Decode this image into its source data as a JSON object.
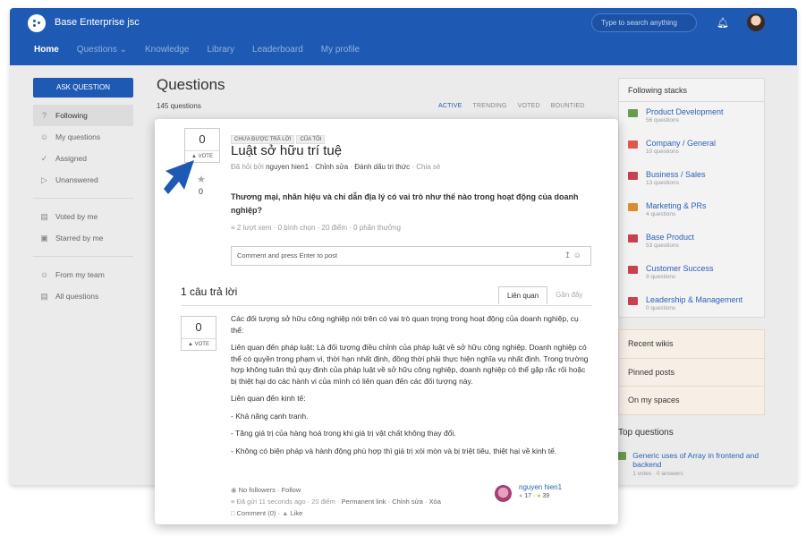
{
  "app": {
    "name": "Base Enterprise jsc",
    "search_placeholder": "Type to search anything"
  },
  "nav": {
    "items": [
      "Home",
      "Questions ⌄",
      "Knowledge",
      "Library",
      "Leaderboard",
      "My profile"
    ]
  },
  "sidebar": {
    "ask_label": "ASK QUESTION",
    "group1": [
      {
        "label": "Following",
        "icon": "question-circle-icon"
      },
      {
        "label": "My questions",
        "icon": "user-icon"
      },
      {
        "label": "Assigned",
        "icon": "check-circle-icon"
      },
      {
        "label": "Unanswered",
        "icon": "paper-plane-icon"
      }
    ],
    "group2": [
      {
        "label": "Voted by me",
        "icon": "vote-box-icon"
      },
      {
        "label": "Starred by me",
        "icon": "star-box-icon"
      }
    ],
    "group3": [
      {
        "label": "From my team",
        "icon": "team-icon"
      },
      {
        "label": "All questions",
        "icon": "document-icon"
      }
    ]
  },
  "main": {
    "title": "Questions",
    "count": "145 questions",
    "tabs": [
      "ACTIVE",
      "TRENDING",
      "VOTED",
      "BOUNTIED"
    ]
  },
  "right": {
    "stacks_title": "Following stacks",
    "stacks": [
      {
        "name": "Product Development",
        "count": "56 questions",
        "color": "#6a9a4b"
      },
      {
        "name": "Company / General",
        "count": "10 questions",
        "color": "#e2574c"
      },
      {
        "name": "Business / Sales",
        "count": "13 questions",
        "color": "#c9404f"
      },
      {
        "name": "Marketing & PRs",
        "count": "4 questions",
        "color": "#e08a2e"
      },
      {
        "name": "Base Product",
        "count": "53 questions",
        "color": "#c9404f"
      },
      {
        "name": "Customer Success",
        "count": "9 questions",
        "color": "#c9404f"
      },
      {
        "name": "Leadership & Management",
        "count": "0 questions",
        "color": "#c9404f"
      }
    ],
    "wiki_items": [
      "Recent wikis",
      "Pinned posts",
      "On my spaces"
    ],
    "top_questions_title": "Top questions",
    "top_question": {
      "title": "Generic uses of Array in frontend and backend",
      "meta": "1 votes · 0 answers"
    }
  },
  "question": {
    "votes": "0",
    "vote_label": "▲ VOTE",
    "stars": "0",
    "tags": [
      "CHƯA ĐƯỢC TRẢ LỜI",
      "CỦA TÔI"
    ],
    "title": "Luật sở hữu trí tuệ",
    "asked_by": "Đã hỏi bởi",
    "author": "nguyen hien1",
    "edit": "Chỉnh sửa",
    "mark": "Đánh dấu tri thức",
    "share": "Chia sẻ",
    "body": "Thương mại, nhãn hiệu và chỉ dẫn địa lý có vai trò như thế nào trong hoạt động của doanh nghiệp?",
    "stats": "≡ 2 lượt xem · 0 bình chọn · 20 điểm · 0 phần thưởng",
    "comment_placeholder": "Comment and press Enter to post"
  },
  "answers": {
    "heading": "1 câu trả lời",
    "tab_relevant": "Liên quan",
    "tab_recent": "Gần đây",
    "votes": "0",
    "vote_label": "▲ VOTE",
    "paragraphs": [
      "Các đối tượng sở hữu công nghiệp nói trên có vai trò quan trọng trong hoạt động của doanh nghiệp, cụ thể:",
      "Liên quan đến pháp luật: Là đối tượng điều chỉnh của pháp luật về sở hữu công nghiệp. Doanh nghiệp có thể có quyền trong phạm vi, thời hạn nhất định, đồng thời phải thực hiện nghĩa vụ nhất định. Trong trường hợp không tuân thủ quy định của pháp luật về sở hữu công nghiệp, doanh nghiệp có thể gặp rắc rối hoặc bị thiệt hại do các hành vi của mình có liên quan đến các đối tượng này.",
      "Liên quan đến kinh tế:",
      "- Khả năng cạnh tranh.",
      "- Tăng giá trị của hàng hoá trong khi giá trị vật chất không thay đổi.",
      "- Không có biện pháp và hành động phù hợp thì giá trị xói mòn và bị triệt tiêu, thiệt hại về kinh tế."
    ],
    "followers": "No followers",
    "follow": "Follow",
    "sent": "Đã gửi 11 seconds ago · 20 điểm ·",
    "permalink": "Permanent link",
    "edit": "Chỉnh sửa",
    "delete": "Xóa",
    "comment": "Comment (0)",
    "like": "Like",
    "author": "nguyen hien1",
    "score1": "17",
    "score2": "39"
  }
}
